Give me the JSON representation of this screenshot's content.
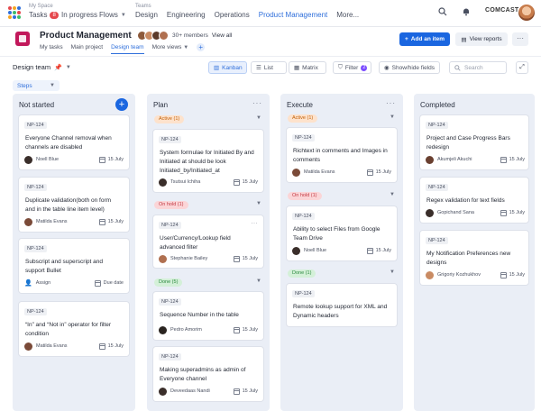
{
  "topnav": {
    "my_space_label": "My Space",
    "tasks_label": "Tasks",
    "tasks_count": "8",
    "in_progress_label": "In progress",
    "flows_label": "Flows",
    "teams_label": "Teams",
    "design_label": "Design",
    "engineering_label": "Engineering",
    "operations_label": "Operations",
    "product_management_label": "Product Management",
    "more_label": "More...",
    "brand": "COMCAST"
  },
  "project": {
    "title": "Product Management",
    "members_text": "30+ members",
    "view_all": "View all",
    "subtabs": [
      "My tasks",
      "Main project",
      "Design team",
      "More views"
    ],
    "add_item_label": "Add an item",
    "view_reports_label": "View reports"
  },
  "toolbar": {
    "board_name": "Design team",
    "kanban": "Kanban",
    "list": "List",
    "matrix": "Matrix",
    "filter": "Filter",
    "filter_count": "2",
    "show_hide": "Show/hide fields",
    "search_placeholder": "Search",
    "steps": "Steps"
  },
  "columns": [
    {
      "title": "Not started",
      "cards": [
        {
          "id": "NP-124",
          "title": "Everyone Channel removal when channels are disabled",
          "assignee": "Noell Blue",
          "date": "15 July"
        },
        {
          "id": "NP-124",
          "title": "Duplicate validation(both on form and in the table line item level)",
          "assignee": "Matilda Evans",
          "date": "15 July"
        },
        {
          "id": "NP-124",
          "title": "Subscript and superscript  and support Bullet",
          "assignee": "Assign",
          "date": "Due date"
        },
        {
          "id": "NP-124",
          "title": "“In” and “Not in” operator for filter condition",
          "assignee": "Matilda Evans",
          "date": "15 July"
        }
      ]
    },
    {
      "title": "Plan",
      "groups": [
        {
          "label": "Active (1)",
          "cards": [
            {
              "id": "NP-124",
              "title": "System formulae for Initiated By and Initiated at should be look Initiated_by/Initiated_at",
              "assignee": "Tsutsui Ichiha",
              "date": "15 July"
            }
          ]
        },
        {
          "label": "On hold (1)",
          "cards": [
            {
              "id": "NP-124",
              "title": "User/Currency/Lookup field advanced filter",
              "assignee": "Stephanie Bailey",
              "date": "15 July"
            }
          ]
        },
        {
          "label": "Done (5)",
          "cards": [
            {
              "id": "NP-124",
              "title": "Sequence Number in the table",
              "assignee": "Pedro Amorim",
              "date": "15 July"
            },
            {
              "id": "NP-124",
              "title": "Making superadmins as admin of Everyone channel",
              "assignee": "Deveedaas Nandi",
              "date": "15 July"
            }
          ]
        }
      ]
    },
    {
      "title": "Execute",
      "groups": [
        {
          "label": "Active (1)",
          "cards": [
            {
              "id": "NP-124",
              "title": "Richtext in comments and Images in comments",
              "assignee": "Matilda Evans",
              "date": "15 July"
            }
          ]
        },
        {
          "label": "On hold (1)",
          "cards": [
            {
              "id": "NP-124",
              "title": "Ability to select Files from Google Team Drive",
              "assignee": "Noell Blue",
              "date": "15 July"
            }
          ]
        },
        {
          "label": "Done (1)",
          "cards": [
            {
              "id": "NP-124",
              "title": "Remote lookup support for XML and Dynamic headers",
              "assignee": "",
              "date": ""
            }
          ]
        }
      ]
    },
    {
      "title": "Completed",
      "cards": [
        {
          "id": "NP-124",
          "title": "Project and Case Progress Bars redesign",
          "assignee": "Akumjeli Akuchi",
          "date": "15 July"
        },
        {
          "id": "NP-124",
          "title": "Regex validation for text fields",
          "assignee": "Gopichand Sana",
          "date": "15 July"
        },
        {
          "id": "NP-124",
          "title": "My Notification Preferences new designs",
          "assignee": "Grigoriy Kozhukhov",
          "date": "15 July"
        }
      ]
    }
  ],
  "colors": {
    "accent": "#1a66e0",
    "active_pill": "#fde2cc",
    "hold_pill": "#fbd5d7",
    "done_pill": "#d4f0d8"
  }
}
